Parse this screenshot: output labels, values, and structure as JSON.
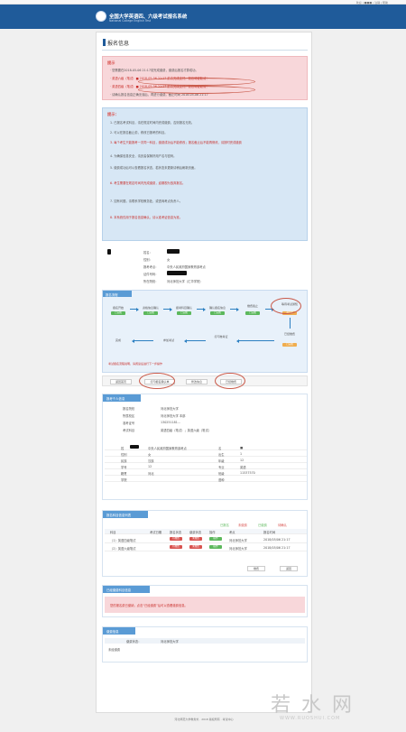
{
  "topbar": {
    "links": "欢迎 | ■■■ | 注销 | 帮助"
  },
  "header": {
    "logo_text": "全国大学英语四、六级考试报名系统",
    "logo_sub": "National College English Test"
  },
  "page": {
    "title": "报名信息"
  },
  "notice": {
    "title": "提示",
    "lines": [
      "· 您需要在2018-05-06 21:17前完成缴费，缴费后报名才算成功。",
      "· 英语六级（笔试）■ 2018-05-06 21:17 前未完成支付，报名将被取消！",
      "· 英语四级（笔试）■ 2018-05-06 21:17 前未完成支付，报名将被取消！",
      "· 请确认报名信息正确无误后，再进行缴费。截止时间 2018-05-06 21:17"
    ]
  },
  "tips": {
    "title": "提示：",
    "lines": [
      "1. 已报名考试科目，请在规定时间内完成缴费，否则报名无效。",
      "2. 可以在报名截止前，修改已报考的科目。",
      "3. 每个考生只能报考一次同一科目，缴费成功后不能修改；报名截止后不能再修改，请按时完成缴费",
      "4. 为确保信息安全，请妥善保管好用户名与密码。",
      "5. 缴费成功后可以查看报名状态，若状态未更新请稍后刷新页面。",
      "6. 考生需要在规定时间内完成缴费，逾期视为放弃报名。",
      "7. 如有问题，请联系学校教务处，或咨询考点负责人。",
      "8. 本系统仅用于报名信息确认，请以准考证信息为准。"
    ]
  },
  "profile": {
    "rows": [
      {
        "label": "姓名：",
        "value": ""
      },
      {
        "label": "性别：",
        "value": "女"
      },
      {
        "label": "报考考点：",
        "value": "中央人民政府国家教育部考点"
      },
      {
        "label": "证件号码：",
        "value": ""
      },
      {
        "label": "所在院校：",
        "value": "河北师范大学（汇华学院）"
      }
    ]
  },
  "flow": {
    "title": "报名流程",
    "nodes_top": [
      "报名开始",
      "资格信息确认",
      "报考科目确认",
      "确认报名信息",
      "缴费截止",
      "等待考试通知"
    ],
    "nodes_bottom": [
      "完成",
      "参加考试",
      "打印准考证",
      "已经缴费"
    ],
    "chips": [
      "已完成",
      "已完成",
      "已完成",
      "已完成",
      "已完成",
      "进行中",
      "已完成"
    ],
    "footer": "考试报名流程说明，请阅读后进行下一步操作"
  },
  "actions": {
    "buttons": [
      "返回首页",
      "打印报名确认单",
      "修改信息",
      "已经缴费"
    ]
  },
  "personal": {
    "title": "报考个人信息",
    "rows": [
      [
        "报名院校",
        "河北师范大学"
      ],
      [
        "所属校区",
        "河北师范大学 本部"
      ],
      [
        "准考证号",
        "130251181..."
      ],
      [
        "考试科目",
        "英语四级（笔试）；英语六级（笔试）"
      ]
    ],
    "grid": [
      [
        "姓",
        "中央人民政府国家教育部考点",
        "名",
        "■"
      ],
      [
        "性别",
        "女",
        "出生",
        "1"
      ],
      [
        "民族",
        "汉族",
        "年级",
        "12"
      ],
      [
        "学号",
        "12",
        "专业",
        "英语"
      ],
      [
        "籍贯",
        "河北",
        "班级",
        "11537570"
      ],
      [
        "学院",
        "",
        "语种",
        ""
      ]
    ]
  },
  "subjects": {
    "title": "报名科目信息列表",
    "status": [
      "已报名",
      "未缴费",
      "已缴费",
      "待确认"
    ],
    "header": [
      "科目",
      "考试日期",
      "报名状态",
      "缴费状态",
      "操作",
      "考点",
      "报名时间"
    ],
    "rows": [
      [
        "（1）英语四级笔试",
        "",
        "待缴费",
        "未缴费",
        "操作",
        "河北师范大学",
        "2018/05/06 21:17"
      ],
      [
        "（2）英语六级笔试",
        "",
        "待缴费",
        "未缴费",
        "操作",
        "河北师范大学",
        "2018/05/06 21:17"
      ]
    ],
    "buttons": [
      "缴费",
      "返回"
    ]
  },
  "paid": {
    "title": "已经缴费科目信息",
    "message": "您的报名费已缴纳，点击“已经缴费”后可以查看缴费信息。"
  },
  "auth": {
    "title": "缴费信息",
    "label": "缴费状态：",
    "value": "河北师范大学",
    "note": "未经缴费"
  },
  "footer": {
    "text": "河北师范大学教务处 · 2018 版权所有 · 考试中心"
  },
  "watermark": {
    "text": "若水网",
    "sub": "WWW.RUOSHUI.COM"
  }
}
